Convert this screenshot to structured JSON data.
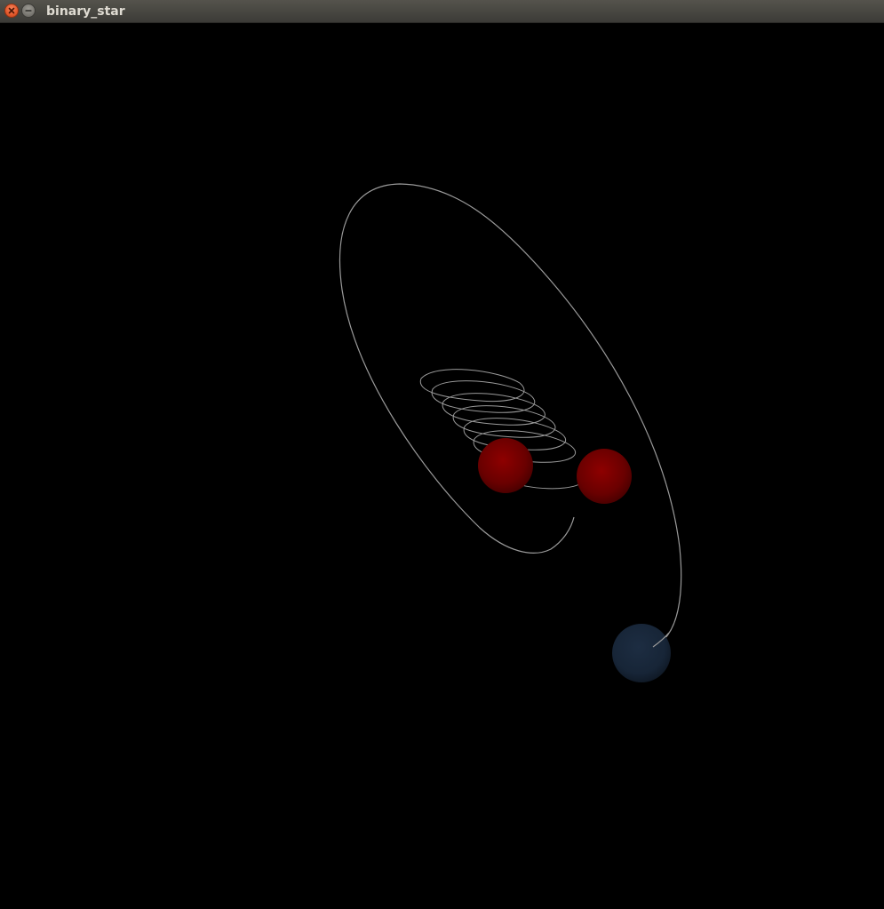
{
  "window": {
    "title": "binary_star"
  },
  "icons": {
    "close": "close-icon",
    "minimize": "minimize-icon"
  },
  "colors": {
    "background": "#000000",
    "trail": "#9a9a9a",
    "binary_star": "#8a0000",
    "third_body": "#1b2a3d"
  },
  "scene": {
    "bodies": [
      {
        "name": "star-a",
        "kind": "binary-star"
      },
      {
        "name": "star-b",
        "kind": "binary-star"
      },
      {
        "name": "third-body",
        "kind": "planet"
      }
    ]
  }
}
